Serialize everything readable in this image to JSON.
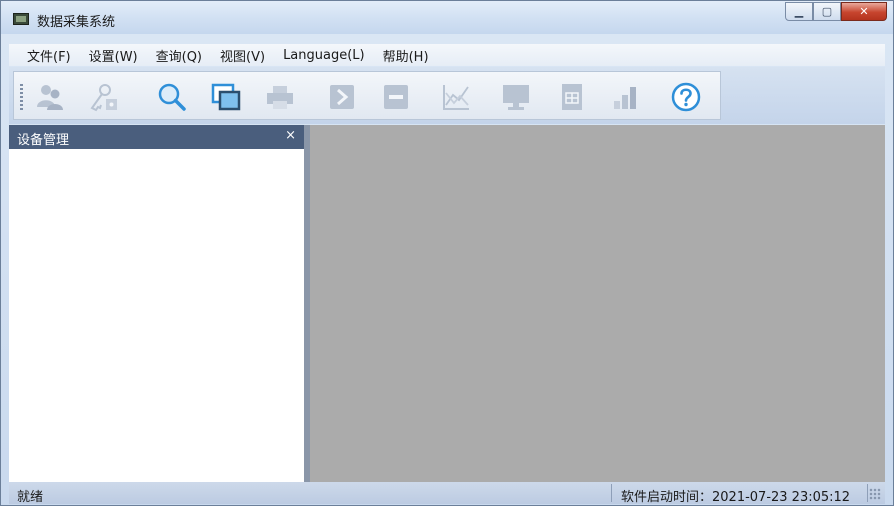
{
  "window": {
    "title": "数据采集系统"
  },
  "menu": [
    {
      "label": "文件(F)"
    },
    {
      "label": "设置(W)"
    },
    {
      "label": "查询(Q)"
    },
    {
      "label": "视图(V)"
    },
    {
      "label": "Language(L)"
    },
    {
      "label": "帮助(H)"
    }
  ],
  "toolbar": [
    {
      "icon": "users-icon",
      "enabled": false
    },
    {
      "icon": "key-user-icon",
      "enabled": false
    },
    {
      "icon": "search-icon",
      "enabled": true
    },
    {
      "icon": "windows-icon",
      "enabled": true
    },
    {
      "icon": "printer-icon",
      "enabled": false
    },
    {
      "icon": "play-icon",
      "enabled": false
    },
    {
      "icon": "stop-icon",
      "enabled": false
    },
    {
      "icon": "line-chart-icon",
      "enabled": false
    },
    {
      "icon": "monitor-icon",
      "enabled": false
    },
    {
      "icon": "spreadsheet-icon",
      "enabled": false
    },
    {
      "icon": "bar-chart-icon",
      "enabled": false
    },
    {
      "icon": "help-icon",
      "enabled": true
    }
  ],
  "left_panel": {
    "title": "设备管理",
    "close": "×"
  },
  "status": {
    "left": "就绪",
    "right": "软件启动时间：2021-07-23 23:05:12"
  },
  "colors": {
    "panel_header": "#4a5e7d",
    "main_bg": "#ababab",
    "icon_disabled": "#b8c3d2",
    "icon_enabled": "#2f8fd8"
  }
}
